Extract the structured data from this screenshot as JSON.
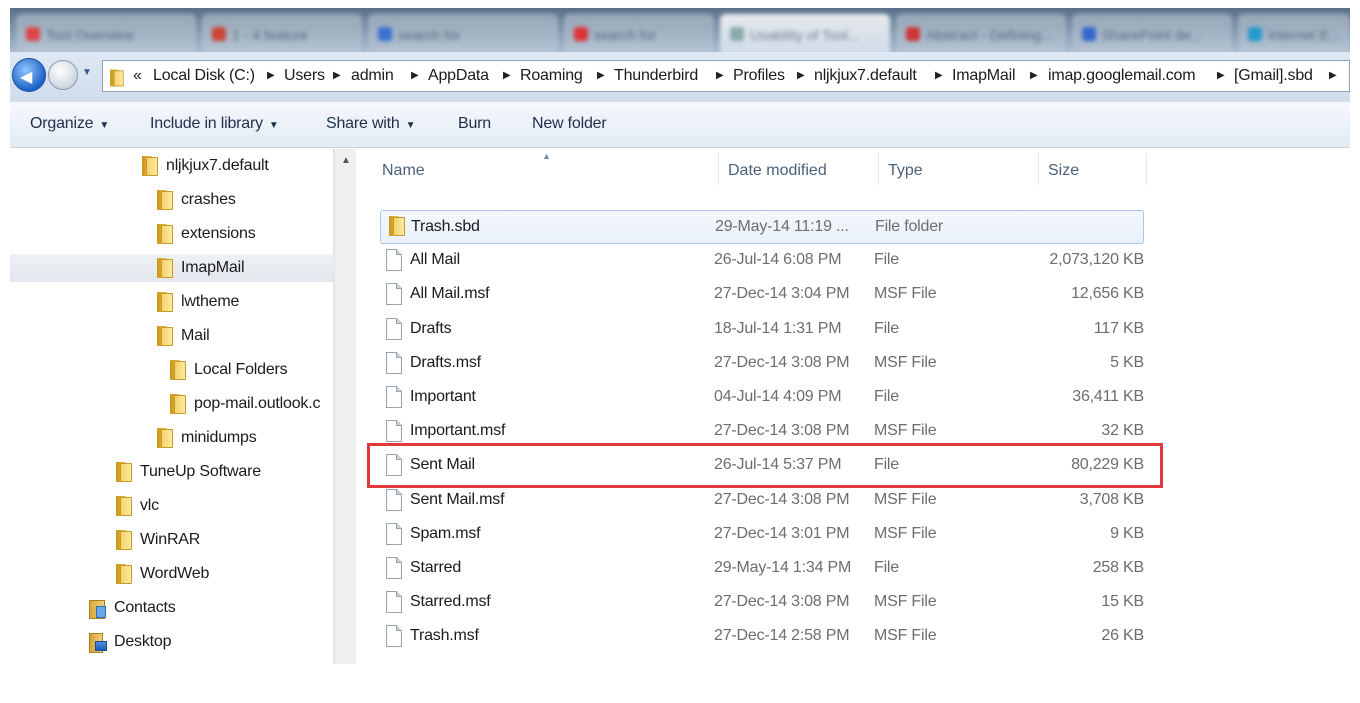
{
  "tabs": [
    {
      "label": "Tool Overview"
    },
    {
      "label": "1 - 4 feature"
    },
    {
      "label": "search for"
    },
    {
      "label": "Usability of Tool..."
    },
    {
      "label": "Abstract - Defining..."
    },
    {
      "label": "SharePoint de..."
    },
    {
      "label": "Internet E..."
    }
  ],
  "address": {
    "overflow": "«",
    "crumbs": [
      "Local Disk (C:)",
      "Users",
      "admin",
      "AppData",
      "Roaming",
      "Thunderbird",
      "Profiles",
      "nljkjux7.default",
      "ImapMail",
      "imap.googlemail.com",
      "[Gmail].sbd"
    ]
  },
  "toolbar": {
    "organize": "Organize",
    "include_in_library": "Include in library",
    "share_with": "Share with",
    "burn": "Burn",
    "new_folder": "New folder"
  },
  "nav": {
    "items": [
      {
        "label": "nljkjux7.default",
        "icon": "folder-icon"
      },
      {
        "label": "crashes",
        "icon": "folder-icon"
      },
      {
        "label": "extensions",
        "icon": "folder-icon"
      },
      {
        "label": "ImapMail",
        "icon": "folder-icon",
        "selected": true
      },
      {
        "label": "lwtheme",
        "icon": "folder-icon"
      },
      {
        "label": "Mail",
        "icon": "folder-icon"
      },
      {
        "label": "Local Folders",
        "icon": "folder-icon"
      },
      {
        "label": "pop-mail.outlook.c",
        "icon": "folder-icon"
      },
      {
        "label": "minidumps",
        "icon": "folder-icon"
      },
      {
        "label": "TuneUp Software",
        "icon": "folder-icon"
      },
      {
        "label": "vlc",
        "icon": "folder-icon"
      },
      {
        "label": "WinRAR",
        "icon": "folder-icon"
      },
      {
        "label": "WordWeb",
        "icon": "folder-icon"
      },
      {
        "label": "Contacts",
        "icon": "contacts-icon"
      },
      {
        "label": "Desktop",
        "icon": "desktop-icon"
      }
    ]
  },
  "columns": {
    "name": "Name",
    "date": "Date modified",
    "type": "Type",
    "size": "Size"
  },
  "files": [
    {
      "name": "Trash.sbd",
      "date": "29-May-14 11:19 ...",
      "type": "File folder",
      "size": "",
      "icon": "folder-icon",
      "selected": true
    },
    {
      "name": "All Mail",
      "date": "26-Jul-14 6:08 PM",
      "type": "File",
      "size": "2,073,120 KB",
      "icon": "file-icon"
    },
    {
      "name": "All Mail.msf",
      "date": "27-Dec-14 3:04 PM",
      "type": "MSF File",
      "size": "12,656 KB",
      "icon": "file-icon"
    },
    {
      "name": "Drafts",
      "date": "18-Jul-14 1:31 PM",
      "type": "File",
      "size": "117 KB",
      "icon": "file-icon"
    },
    {
      "name": "Drafts.msf",
      "date": "27-Dec-14 3:08 PM",
      "type": "MSF File",
      "size": "5 KB",
      "icon": "file-icon"
    },
    {
      "name": "Important",
      "date": "04-Jul-14 4:09 PM",
      "type": "File",
      "size": "36,411 KB",
      "icon": "file-icon"
    },
    {
      "name": "Important.msf",
      "date": "27-Dec-14 3:08 PM",
      "type": "MSF File",
      "size": "32 KB",
      "icon": "file-icon"
    },
    {
      "name": "Sent Mail",
      "date": "26-Jul-14 5:37 PM",
      "type": "File",
      "size": "80,229 KB",
      "icon": "file-icon",
      "highlighted": true
    },
    {
      "name": "Sent Mail.msf",
      "date": "27-Dec-14 3:08 PM",
      "type": "MSF File",
      "size": "3,708 KB",
      "icon": "file-icon"
    },
    {
      "name": "Spam.msf",
      "date": "27-Dec-14 3:01 PM",
      "type": "MSF File",
      "size": "9 KB",
      "icon": "file-icon"
    },
    {
      "name": "Starred",
      "date": "29-May-14 1:34 PM",
      "type": "File",
      "size": "258 KB",
      "icon": "file-icon"
    },
    {
      "name": "Starred.msf",
      "date": "27-Dec-14 3:08 PM",
      "type": "MSF File",
      "size": "15 KB",
      "icon": "file-icon"
    },
    {
      "name": "Trash.msf",
      "date": "27-Dec-14 2:58 PM",
      "type": "MSF File",
      "size": "26 KB",
      "icon": "file-icon"
    }
  ],
  "colors": {
    "highlight_box": "#e0383b",
    "selection_border": "#aac7ea",
    "folder_yellow": "#f5d26b"
  }
}
